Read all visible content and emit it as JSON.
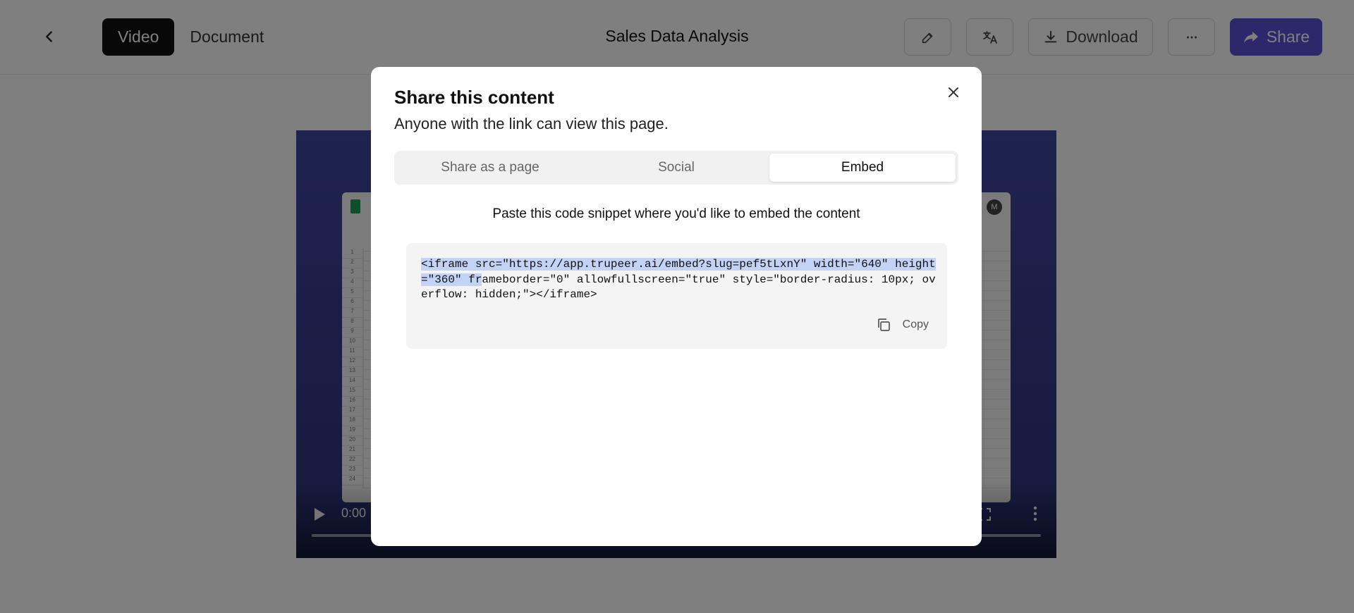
{
  "topbar": {
    "title": "Sales Data Analysis",
    "mode_tabs": [
      "Video",
      "Document"
    ],
    "active_mode": "Video",
    "download_label": "Download",
    "share_label": "Share"
  },
  "video": {
    "time": "0:00",
    "avatar_initial": "M"
  },
  "modal": {
    "title": "Share this content",
    "subtitle": "Anyone with the link can view this page.",
    "tabs": [
      "Share as a page",
      "Social",
      "Embed"
    ],
    "active_tab": "Embed",
    "instruction": "Paste this code snippet where you'd like to embed the content",
    "code_selected": "<iframe src=\"https://app.trupeer.ai/embed?slug=pef5tLxnY\" width=\"640\" height=\"360\" fr",
    "code_rest": "ameborder=\"0\" allowfullscreen=\"true\" style=\"border-radius: 10px; overflow: hidden;\"></iframe>",
    "copy_label": "Copy"
  },
  "colors": {
    "share_accent": "#5b50d6",
    "selection": "#c3d3f5",
    "video_bg": "#3e46a0"
  },
  "icons": [
    "chevron-left-icon",
    "edit-icon",
    "translate-icon",
    "download-icon",
    "more-icon",
    "share-arrow-icon",
    "close-icon",
    "copy-icon",
    "play-icon",
    "fullscreen-icon",
    "kebab-icon"
  ]
}
